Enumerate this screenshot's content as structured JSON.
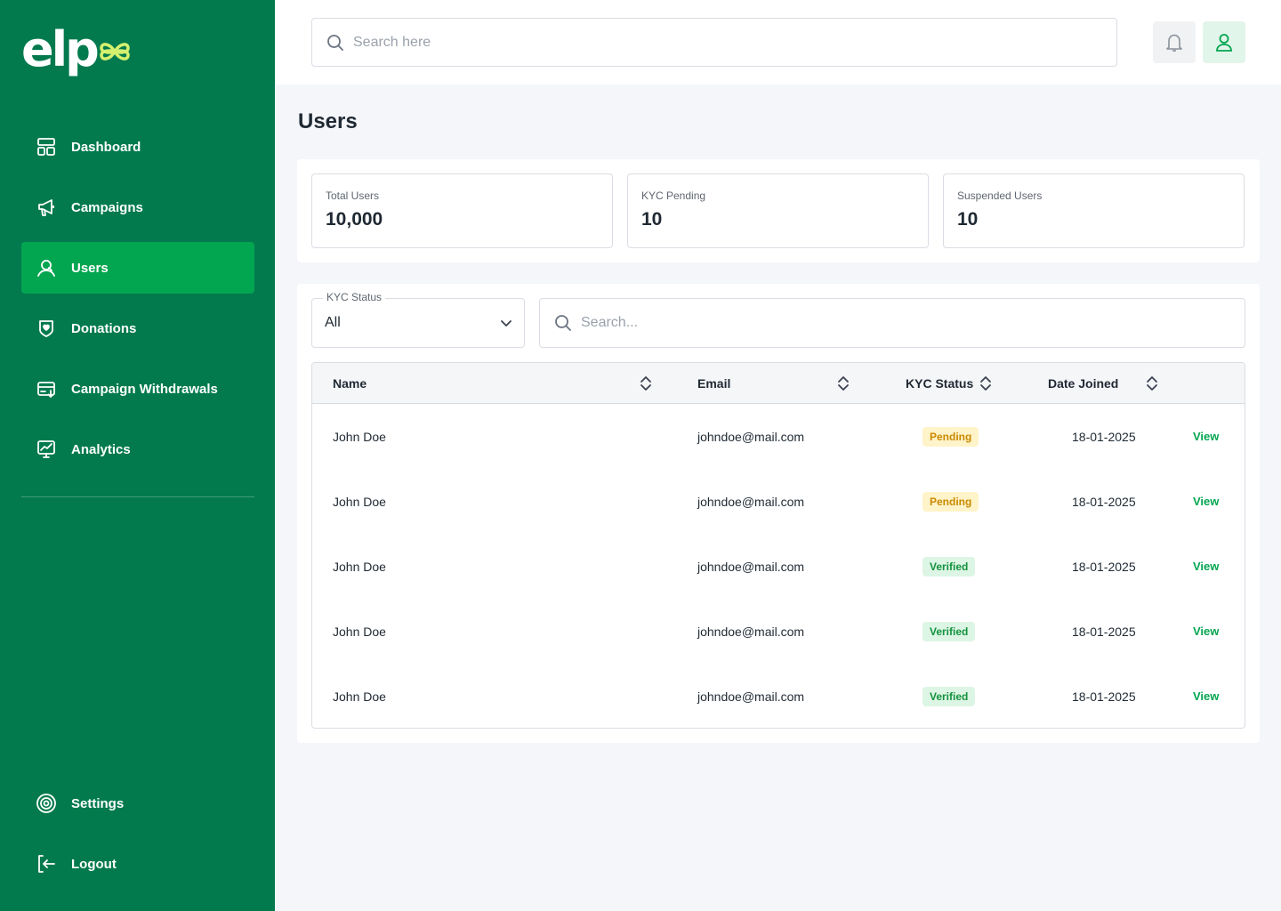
{
  "logo": {
    "text": "elp"
  },
  "sidebar": {
    "items": [
      {
        "label": "Dashboard",
        "icon": "dashboard-icon"
      },
      {
        "label": "Campaigns",
        "icon": "megaphone-icon"
      },
      {
        "label": "Users",
        "icon": "users-icon",
        "active": true
      },
      {
        "label": "Donations",
        "icon": "donations-icon"
      },
      {
        "label": "Campaign Withdrawals",
        "icon": "withdrawal-icon"
      },
      {
        "label": "Analytics",
        "icon": "analytics-icon"
      }
    ],
    "bottom_items": [
      {
        "label": "Settings",
        "icon": "gear-icon"
      },
      {
        "label": "Logout",
        "icon": "logout-icon"
      }
    ]
  },
  "topbar": {
    "search_placeholder": "Search here"
  },
  "page": {
    "title": "Users"
  },
  "stats": [
    {
      "label": "Total Users",
      "value": "10,000"
    },
    {
      "label": "KYC Pending",
      "value": "10"
    },
    {
      "label": "Suspended Users",
      "value": "10"
    }
  ],
  "filters": {
    "kyc_label": "KYC Status",
    "kyc_value": "All",
    "search_placeholder": "Search..."
  },
  "table": {
    "columns": [
      "Name",
      "Email",
      "KYC Status",
      "Date Joined"
    ],
    "rows": [
      {
        "name": "John Doe",
        "email": "johndoe@mail.com",
        "status": "Pending",
        "date": "18-01-2025",
        "action": "View"
      },
      {
        "name": "John Doe",
        "email": "johndoe@mail.com",
        "status": "Pending",
        "date": "18-01-2025",
        "action": "View"
      },
      {
        "name": "John Doe",
        "email": "johndoe@mail.com",
        "status": "Verified",
        "date": "18-01-2025",
        "action": "View"
      },
      {
        "name": "John Doe",
        "email": "johndoe@mail.com",
        "status": "Verified",
        "date": "18-01-2025",
        "action": "View"
      },
      {
        "name": "John Doe",
        "email": "johndoe@mail.com",
        "status": "Verified",
        "date": "18-01-2025",
        "action": "View"
      }
    ]
  },
  "colors": {
    "sidebar": "#027a4e",
    "active": "#03a650",
    "logo_accent": "#d4f06e",
    "pending_bg": "#fff3c9",
    "pending_text": "#c98a00",
    "verified_bg": "#ddf5e4",
    "verified_text": "#13923e"
  }
}
